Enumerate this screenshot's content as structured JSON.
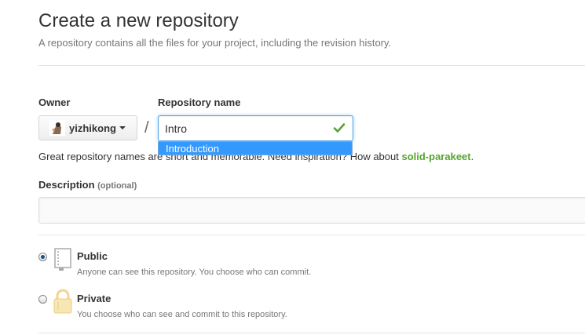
{
  "header": {
    "title": "Create a new repository",
    "subtitle": "A repository contains all the files for your project, including the revision history."
  },
  "owner": {
    "label": "Owner",
    "name": "yizhikong"
  },
  "separator": "/",
  "repo_name": {
    "label": "Repository name",
    "value": "Intro",
    "status_icon": "check-icon",
    "autocomplete_suggestion": "Introduction"
  },
  "hint": {
    "prefix": "Great repository names are short and memorable. Need inspiration? How about ",
    "suggestion": "solid-parakeet",
    "suffix": "."
  },
  "description": {
    "label": "Description",
    "optional": "(optional)",
    "value": ""
  },
  "visibility": {
    "selected": "public",
    "options": [
      {
        "id": "public",
        "title": "Public",
        "description": "Anyone can see this repository. You choose who can commit.",
        "icon": "book-icon"
      },
      {
        "id": "private",
        "title": "Private",
        "description": "You choose who can see and commit to this repository.",
        "icon": "lock-icon"
      }
    ]
  },
  "colors": {
    "accent_blue": "#51a7e8",
    "success_green": "#55a532",
    "autocomplete_bg": "#3399ff",
    "lock_gold": "#f0d58b"
  }
}
